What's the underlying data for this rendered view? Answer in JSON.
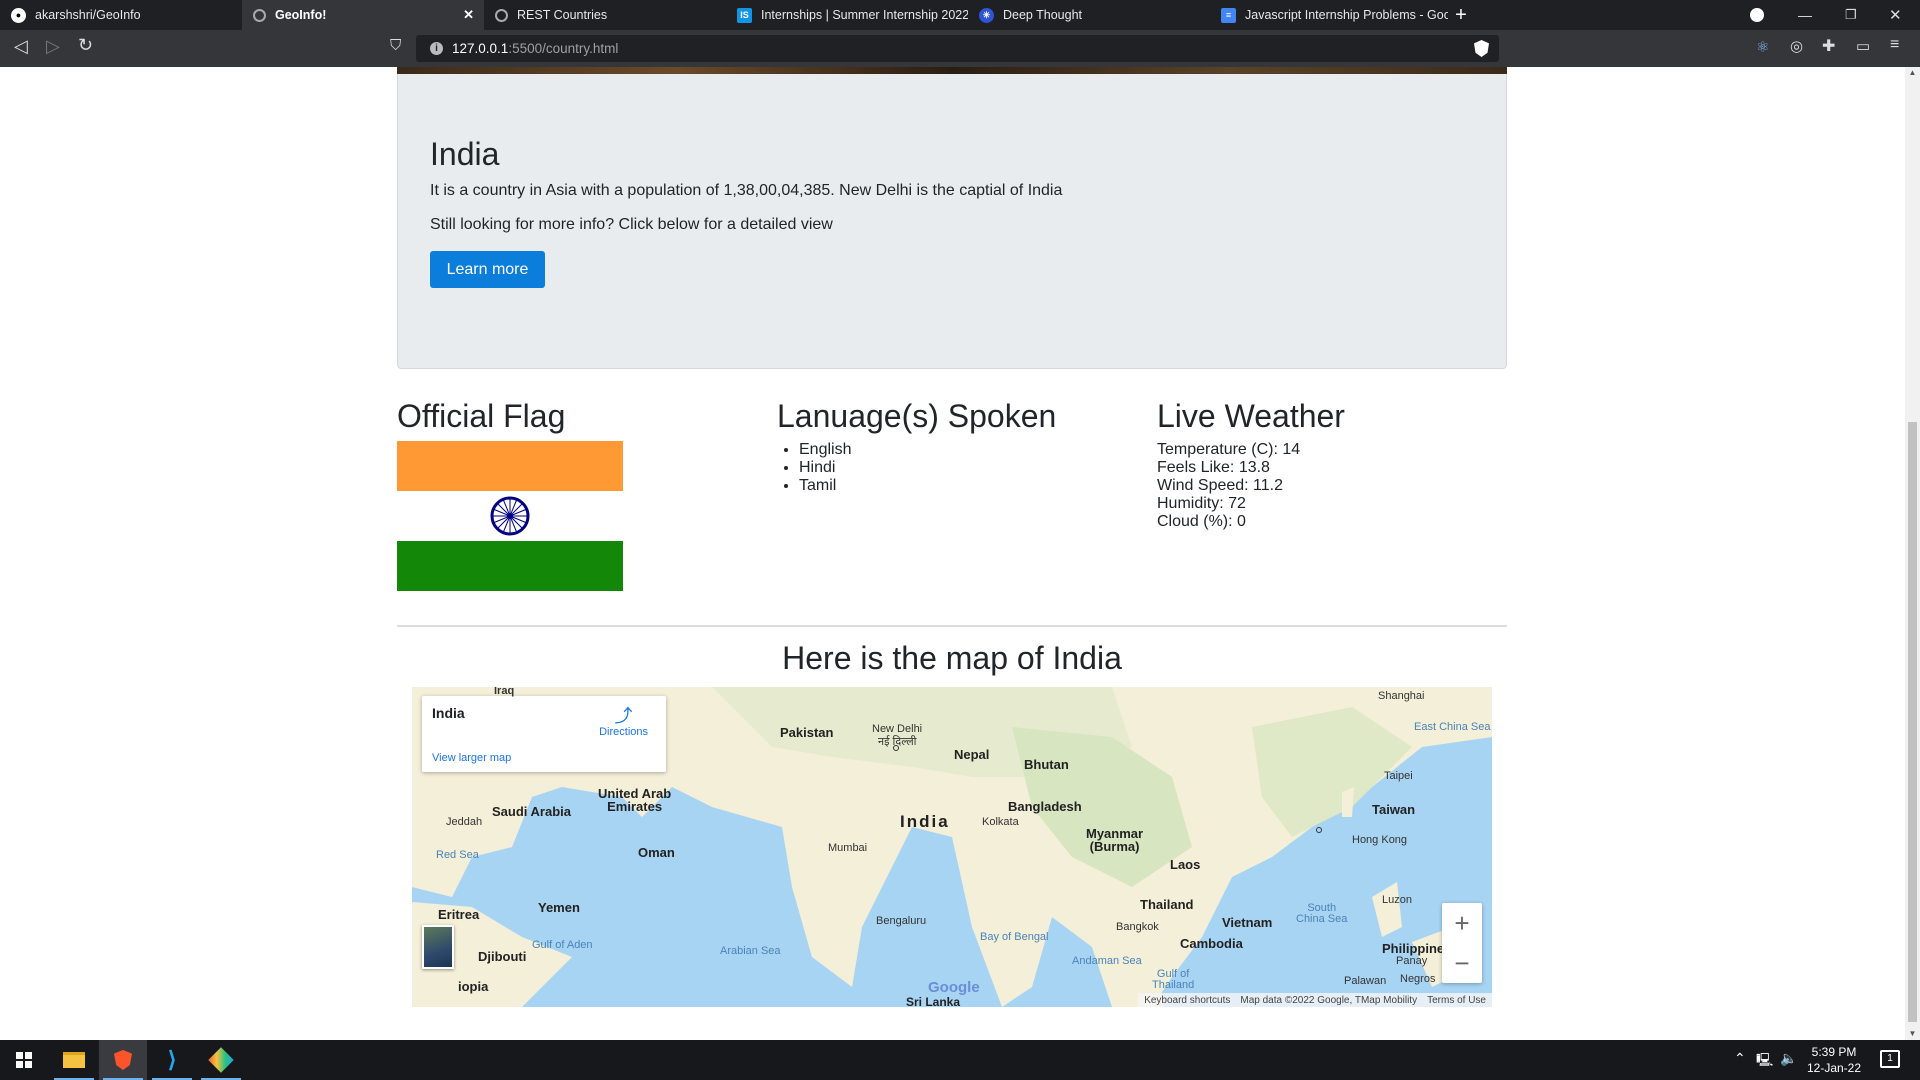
{
  "browser": {
    "tabs": [
      {
        "label": "akarshshri/GeoInfo",
        "icon": "github-icon"
      },
      {
        "label": "GeoInfo!",
        "icon": "globe-icon",
        "active": true
      },
      {
        "label": "REST Countries",
        "icon": "globe-icon"
      },
      {
        "label": "Internships | Summer Internship 2022",
        "icon": "internshala-icon"
      },
      {
        "label": "Deep Thought",
        "icon": "deepthought-icon"
      },
      {
        "label": "Javascript Internship Problems - Goog",
        "icon": "docs-icon"
      }
    ],
    "url_host": "127.0.0.1",
    "url_path": ":5500/country.html"
  },
  "country": {
    "name": "India",
    "description": "It is a country in Asia with a population of 1,38,00,04,385. New Delhi is the captial of India",
    "more_info": "Still looking for more info? Click below for a detailed view",
    "learn_more_label": "Learn more"
  },
  "flag": {
    "heading": "Official Flag",
    "colors": {
      "saffron": "#ff9933",
      "white": "#ffffff",
      "green": "#138808",
      "chakra": "#000080"
    }
  },
  "languages": {
    "heading": "Lanuage(s) Spoken",
    "items": [
      "English",
      "Hindi",
      "Tamil"
    ]
  },
  "weather": {
    "heading": "Live Weather",
    "temperature": "Temperature (C): 14",
    "feels_like": "Feels Like: 13.8",
    "wind_speed": "Wind Speed: 11.2",
    "humidity": "Humidity: 72",
    "cloud": "Cloud (%): 0"
  },
  "map": {
    "heading": "Here is the map of India",
    "card_title": "India",
    "directions": "Directions",
    "view_larger": "View larger map",
    "labels": {
      "pakistan": "Pakistan",
      "new_delhi": "New Delhi",
      "new_delhi_hi": "नई दिल्ली",
      "nepal": "Nepal",
      "bhutan": "Bhutan",
      "bangladesh": "Bangladesh",
      "india": "India",
      "kolkata": "Kolkata",
      "myanmar": "Myanmar\n(Burma)",
      "mumbai": "Mumbai",
      "bengaluru": "Bengaluru",
      "laos": "Laos",
      "thailand": "Thailand",
      "bangkok": "Bangkok",
      "vietnam": "Vietnam",
      "cambodia": "Cambodia",
      "hong_kong": "Hong Kong",
      "taiwan": "Taiwan",
      "taipei": "Taipei",
      "shanghai": "Shanghai",
      "east_china_sea": "East China Sea",
      "south_china_sea": "South\nChina Sea",
      "luzon": "Luzon",
      "philippines": "Philippine",
      "panay": "Panay",
      "palawan": "Palawan",
      "negros": "Negros",
      "iraq": "Iraq",
      "saudi_arabia": "Saudi Arabia",
      "uae": "United Arab\nEmirates",
      "jeddah": "Jeddah",
      "oman": "Oman",
      "red_sea": "Red Sea",
      "eritrea": "Eritrea",
      "yemen": "Yemen",
      "gulf_of_aden": "Gulf of Aden",
      "djibouti": "Djibouti",
      "ethiopia": "iopia",
      "arabian_sea": "Arabian Sea",
      "bay_of_bengal": "Bay of Bengal",
      "andaman_sea": "Andaman Sea",
      "gulf_of_thailand": "Gulf of\nThailand",
      "sri_lanka": "Sri Lanka"
    },
    "google": "Google",
    "attribution": [
      "Keyboard shortcuts",
      "Map data ©2022 Google, TMap Mobility",
      "Terms of Use"
    ]
  },
  "taskbar": {
    "time": "5:39 PM",
    "date": "12-Jan-22",
    "notifications": "1"
  }
}
